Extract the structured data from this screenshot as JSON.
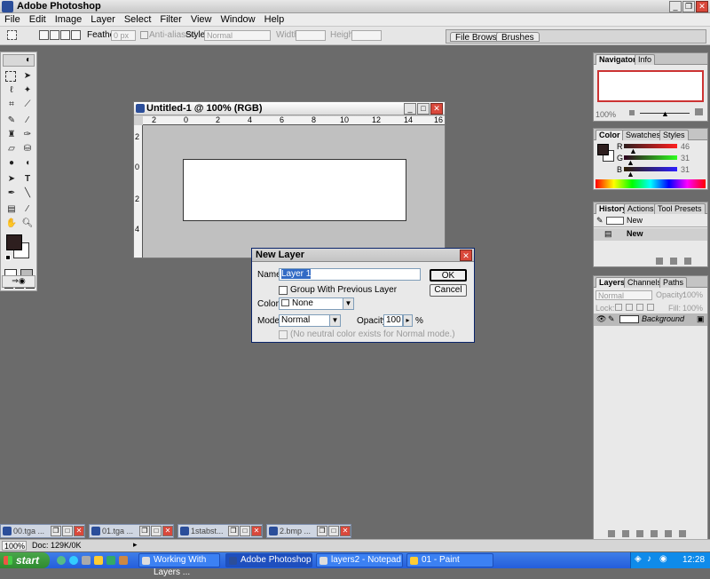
{
  "app": {
    "title": "Adobe Photoshop"
  },
  "menu": [
    "File",
    "Edit",
    "Image",
    "Layer",
    "Select",
    "Filter",
    "View",
    "Window",
    "Help"
  ],
  "options": {
    "feather_label": "Feather:",
    "feather_value": "0 px",
    "antialiased": "Anti-aliased",
    "style_label": "Style:",
    "style_value": "Normal",
    "width_label": "Width:",
    "height_label": "Height:",
    "tabs": [
      "File Browser",
      "Brushes"
    ]
  },
  "document": {
    "title": "Untitled-1 @ 100% (RGB)",
    "ruler_h": [
      "2",
      "0",
      "2",
      "4",
      "6",
      "8",
      "10",
      "12",
      "14",
      "16"
    ],
    "ruler_v": [
      "2",
      "0",
      "2",
      "4"
    ]
  },
  "dialog": {
    "title": "New Layer",
    "name_label": "Name:",
    "name_value": "Layer 1",
    "group_label": "Group With Previous Layer",
    "color_label": "Color:",
    "color_value": "None",
    "mode_label": "Mode:",
    "mode_value": "Normal",
    "opacity_label": "Opacity:",
    "opacity_value": "100",
    "opacity_unit": "%",
    "neutral_label": "(No neutral color exists for Normal mode.)",
    "ok": "OK",
    "cancel": "Cancel"
  },
  "navigator": {
    "tabs": [
      "Navigator",
      "Info"
    ],
    "zoom": "100%"
  },
  "color": {
    "tabs": [
      "Color",
      "Swatches",
      "Styles"
    ],
    "r": "46",
    "g": "31",
    "b": "31",
    "r_label": "R",
    "g_label": "G",
    "b_label": "B"
  },
  "history": {
    "tabs": [
      "History",
      "Actions",
      "Tool Presets"
    ],
    "items": [
      "New",
      "New"
    ]
  },
  "layers": {
    "tabs": [
      "Layers",
      "Channels",
      "Paths"
    ],
    "mode": "Normal",
    "opacity_label": "Opacity:",
    "opacity": "100%",
    "lock_label": "Lock:",
    "fill_label": "Fill:",
    "fill": "100%",
    "layer_name": "Background"
  },
  "minimized": [
    "00.tga ...",
    "01.tga ...",
    "1stabst...",
    "2.bmp ..."
  ],
  "status": {
    "zoom": "100%",
    "doc": "Doc: 129K/0K"
  },
  "taskbar": {
    "start": "start",
    "tasks": [
      "Working With Layers ...",
      "Adobe Photoshop",
      "layers2 - Notepad",
      "01 - Paint"
    ],
    "time": "12:28"
  }
}
